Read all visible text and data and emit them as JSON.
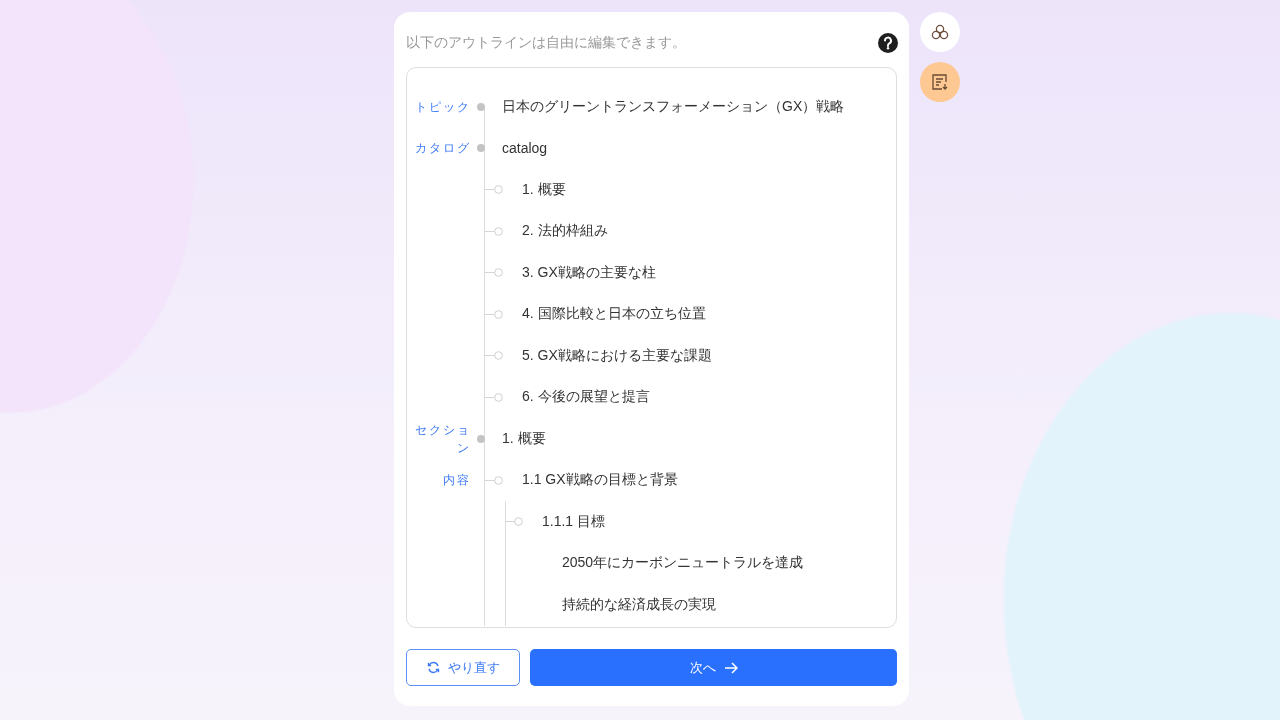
{
  "header": {
    "instruction": "以下のアウトラインは自由に編集できます。"
  },
  "outline": [
    {
      "kind": "root",
      "label": "トピック",
      "text": "日本のグリーントランスフォーメーション（GX）戦略"
    },
    {
      "kind": "root",
      "label": "カタログ",
      "text": "catalog",
      "children": [
        {
          "kind": "heading",
          "text": "1. 概要"
        },
        {
          "kind": "heading",
          "text": "2. 法的枠組み"
        },
        {
          "kind": "heading",
          "text": "3. GX戦略の主要な柱"
        },
        {
          "kind": "heading",
          "text": "4. 国際比較と日本の立ち位置"
        },
        {
          "kind": "heading",
          "text": "5. GX戦略における主要な課題"
        },
        {
          "kind": "heading",
          "text": "6. 今後の展望と提言"
        }
      ]
    },
    {
      "kind": "root",
      "label": "セクション",
      "text": "1. 概要",
      "children": [
        {
          "kind": "heading",
          "label": "内容",
          "text": "1.1 GX戦略の目標と背景",
          "children": [
            {
              "kind": "heading",
              "text": "1.1.1 目標",
              "children": [
                {
                  "kind": "point",
                  "text": "2050年にカーボンニュートラルを達成"
                },
                {
                  "kind": "point",
                  "text": "持続的な経済成長の実現"
                }
              ]
            }
          ]
        }
      ]
    }
  ],
  "buttons": {
    "retry": "やり直す",
    "next": "次へ"
  }
}
